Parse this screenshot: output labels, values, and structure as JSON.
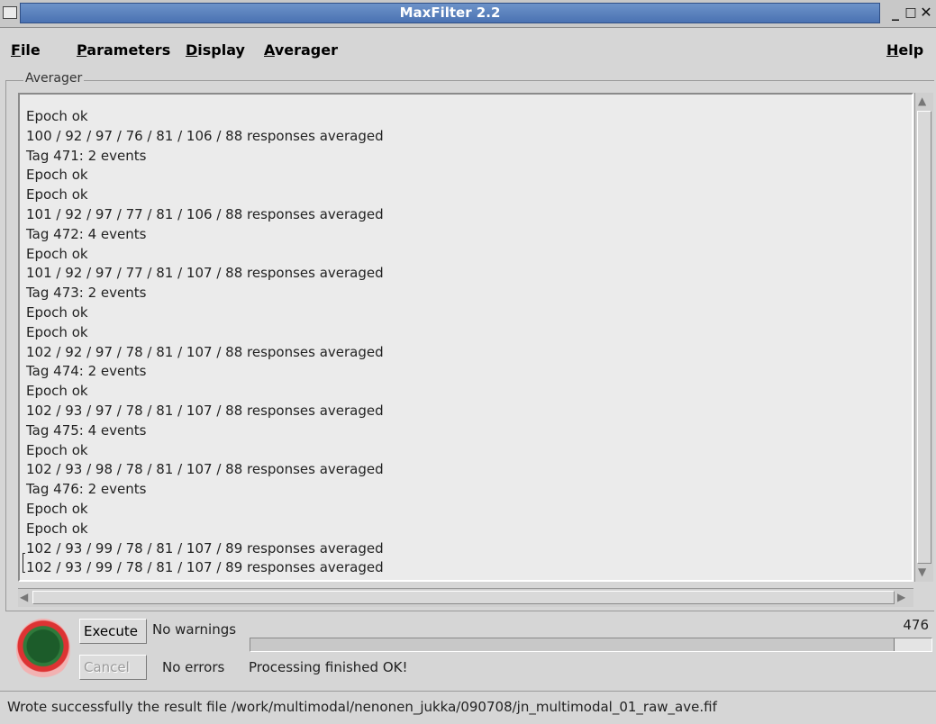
{
  "window": {
    "title": "MaxFilter 2.2",
    "minimize_label": "_",
    "maximize_label": "□",
    "close_label": "✕"
  },
  "menu": {
    "file": "File",
    "parameters": "Parameters",
    "display": "Display",
    "averager": "Averager",
    "help": "Help"
  },
  "averager_panel": {
    "label": "Averager",
    "log_lines": [
      "Epoch ok",
      "100 / 92 / 97 / 76 / 81 / 106 / 88 responses averaged",
      "Tag 471: 2 events",
      "Epoch ok",
      "Epoch ok",
      "101 / 92 / 97 / 77 / 81 / 106 / 88 responses averaged",
      "Tag 472: 4 events",
      "Epoch ok",
      "101 / 92 / 97 / 77 / 81 / 107 / 88 responses averaged",
      "Tag 473: 2 events",
      "Epoch ok",
      "Epoch ok",
      "102 / 92 / 97 / 78 / 81 / 107 / 88 responses averaged",
      "Tag 474: 2 events",
      "Epoch ok",
      "102 / 93 / 97 / 78 / 81 / 107 / 88 responses averaged",
      "Tag 475: 4 events",
      "Epoch ok",
      "102 / 93 / 98 / 78 / 81 / 107 / 88 responses averaged",
      "Tag 476: 2 events",
      "Epoch ok",
      "Epoch ok",
      "102 / 93 / 99 / 78 / 81 / 107 / 89 responses averaged",
      "102 / 93 / 99 / 78 / 81 / 107 / 89 responses averaged"
    ]
  },
  "controls": {
    "execute_label": "Execute",
    "cancel_label": "Cancel",
    "warnings_text": "No warnings",
    "errors_text": "No errors",
    "processing_text": "Processing finished OK!",
    "counter": "476"
  },
  "status_bar": {
    "message": "Wrote successfully the result file /work/multimodal/nenonen_jukka/090708/jn_multimodal_01_raw_ave.fif"
  }
}
